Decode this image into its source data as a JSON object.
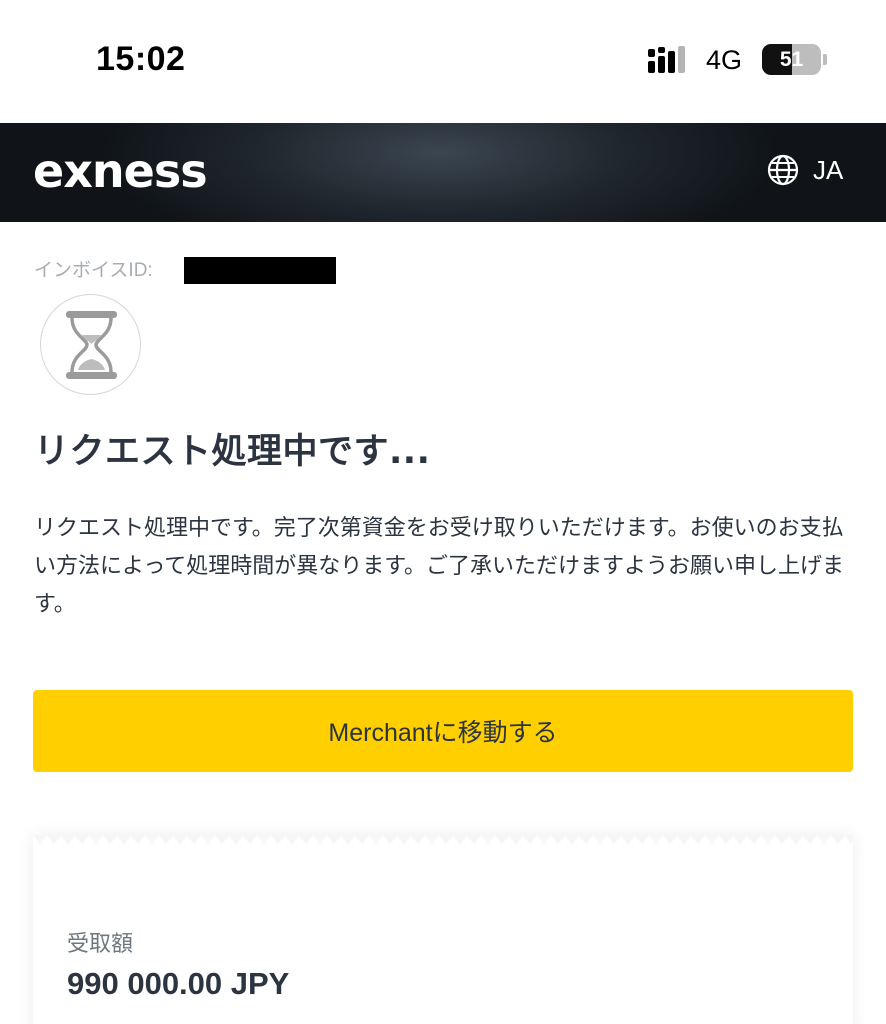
{
  "status_bar": {
    "time": "15:02",
    "network": "4G",
    "battery_level": "51",
    "battery_fraction": 0.51,
    "signal_icon": "cellular-signal-icon",
    "battery_icon": "battery-icon"
  },
  "header": {
    "brand": "exness",
    "language": "JA",
    "language_icon": "globe-icon"
  },
  "invoice": {
    "label": "インボイスID:"
  },
  "status": {
    "icon": "hourglass-icon",
    "title": "リクエスト処理中です...",
    "description": "リクエスト処理中です。完了次第資金をお受け取りいただけます。お使いのお支払い方法によって処理時間が異なります。ご了承いただけますようお願い申し上げます。"
  },
  "actions": {
    "merchant_button": "Merchantに移動する"
  },
  "receipt": {
    "received_label": "受取額",
    "received_amount": "990 000.00 JPY"
  },
  "colors": {
    "accent": "#ffcf00",
    "header_dark": "#1f262d",
    "text": "#2b3440",
    "muted": "#a7adb3"
  }
}
